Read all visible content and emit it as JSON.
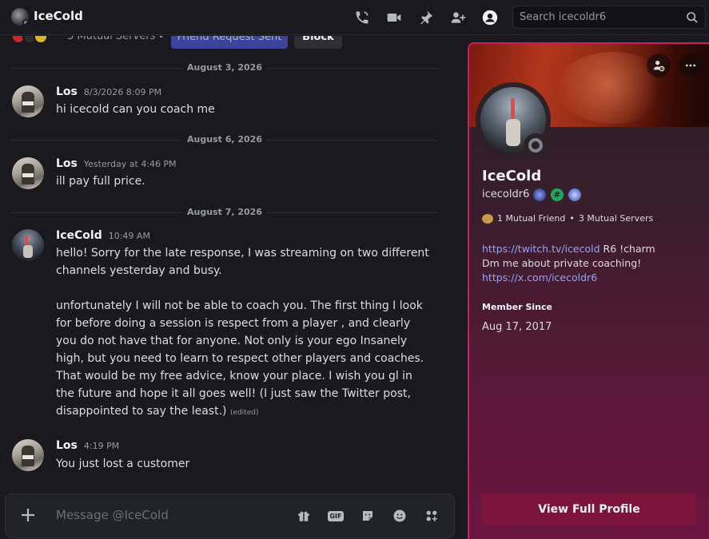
{
  "header": {
    "title": "IceCold",
    "search_placeholder": "Search icecoldr6"
  },
  "profile_strip": {
    "mutual_servers": "3 Mutual Servers",
    "separator": "•",
    "friend_request_label": "Friend Request Sent",
    "block_label": "Block"
  },
  "dividers": [
    "August 3, 2026",
    "August 6, 2026",
    "August 7, 2026"
  ],
  "messages": [
    {
      "author": "Los",
      "time": "8/3/2026 8:09 PM",
      "text": "hi icecold can you coach me"
    },
    {
      "author": "Los",
      "time": "Yesterday at 4:46 PM",
      "text": "ill pay full price."
    },
    {
      "author": "IceCold",
      "time": "10:49 AM",
      "paragraph1": "hello! Sorry for the late response, I was streaming on two different channels yesterday and busy.",
      "paragraph2": "unfortunately I will not be able to coach you. The first thing I look for before doing a session is respect from a player , and clearly you do not have that for anyone. Not only is your ego Insanely high, but you need to learn to respect other players and coaches. That would be my free advice, know your place. I wish you gl in the future and hope it all goes well! (I just saw the Twitter post, disappointed to say the least.)",
      "edited": "(edited)"
    },
    {
      "author": "Los",
      "time": "4:19 PM",
      "text": "You just lost a customer"
    }
  ],
  "composer": {
    "placeholder": "Message @IceCold",
    "gif_label": "GIF"
  },
  "profile": {
    "display_name": "IceCold",
    "username": "icecoldr6",
    "mutual_friends": "1 Mutual Friend",
    "separator": "•",
    "mutual_servers": "3 Mutual Servers",
    "bio_link1": "https://twitch.tv/icecold",
    "bio_link1_suffix": " R6 !charm",
    "bio_line2": "Dm me about private coaching!",
    "bio_link2": "https://x.com/icecoldr6",
    "member_since_label": "Member Since",
    "member_since_value": "Aug 17, 2017",
    "view_full_profile": "View Full Profile",
    "accent_color": "#c81f62"
  }
}
